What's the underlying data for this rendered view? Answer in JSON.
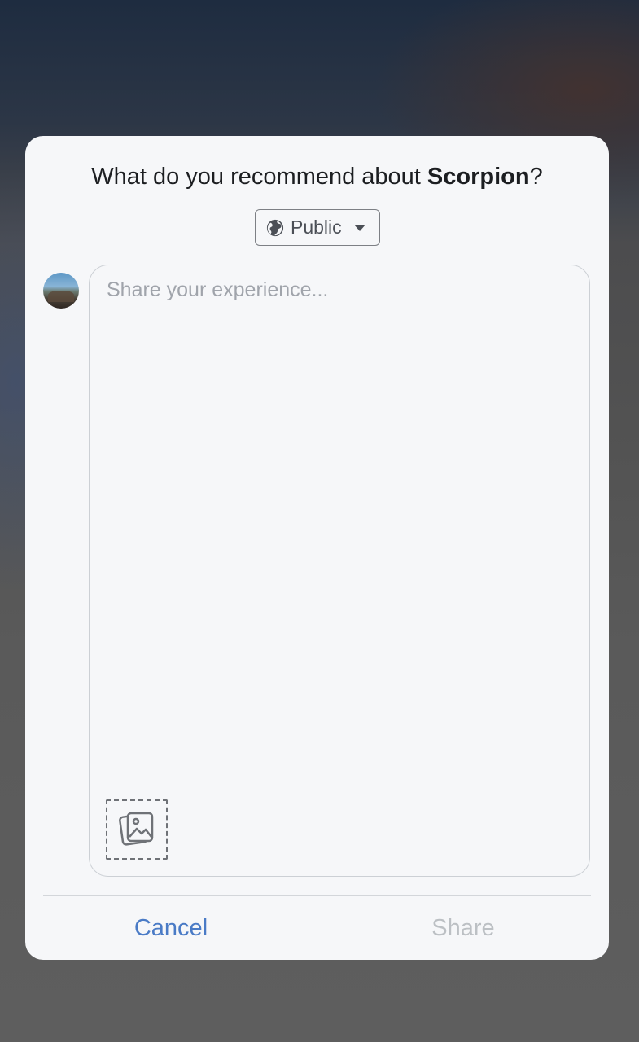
{
  "dialog": {
    "title_prefix": "What do you recommend about ",
    "title_subject": "Scorpion",
    "title_suffix": "?"
  },
  "privacy": {
    "label": "Public",
    "icon": "globe-icon",
    "dropdown_icon": "caret-down-icon"
  },
  "composer": {
    "placeholder": "Share your experience...",
    "value": "",
    "add_photo_icon": "add-photo-icon"
  },
  "actions": {
    "cancel_label": "Cancel",
    "share_label": "Share"
  },
  "colors": {
    "link_blue": "#4a7bc6",
    "disabled_gray": "#bcc0c4",
    "modal_bg": "#f6f7f9"
  }
}
